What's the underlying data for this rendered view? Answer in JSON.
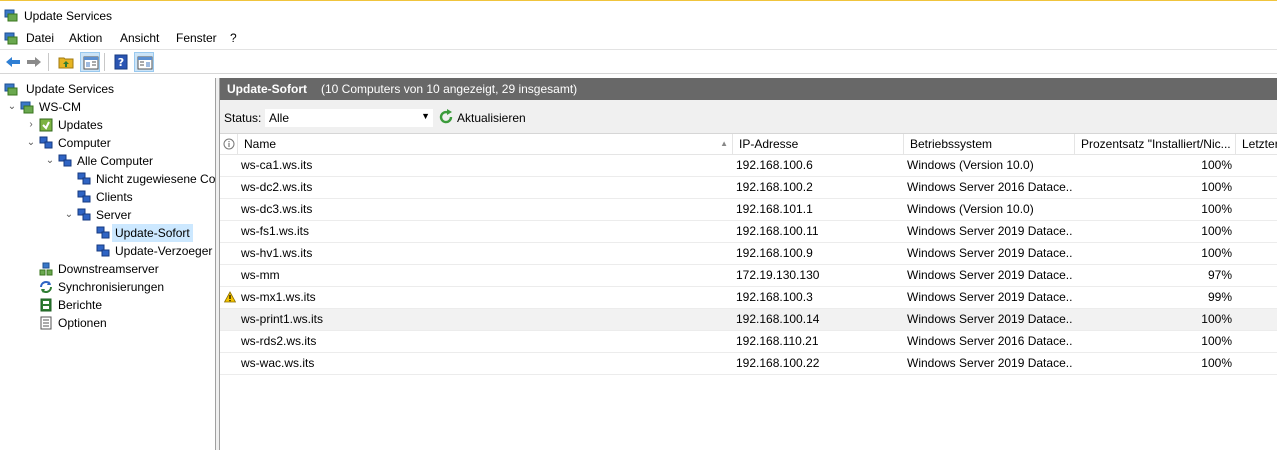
{
  "window": {
    "title": "Update Services"
  },
  "menu": {
    "items": [
      "Datei",
      "Aktion",
      "Ansicht",
      "Fenster",
      "?"
    ]
  },
  "toolbar": {
    "buttons": [
      "back-icon",
      "forward-icon",
      "folder-up-icon",
      "show-hide-tree-icon",
      "help-icon",
      "action-pane-icon"
    ]
  },
  "tree": {
    "root": "Update Services",
    "server": "WS-CM",
    "updates": "Updates",
    "computer": "Computer",
    "all_computers": "Alle Computer",
    "unassigned": "Nicht zugewiesene Co",
    "clients": "Clients",
    "server_group": "Server",
    "update_sofort": "Update-Sofort",
    "update_verzoeger": "Update-Verzoeger",
    "downstream": "Downstreamserver",
    "sync": "Synchronisierungen",
    "reports": "Berichte",
    "options": "Optionen"
  },
  "header": {
    "title": "Update-Sofort",
    "subtitle": "(10 Computers von 10 angezeigt, 29 insgesamt)"
  },
  "filter": {
    "status_label": "Status:",
    "status_value": "Alle",
    "refresh_label": "Aktualisieren"
  },
  "columns": {
    "name": "Name",
    "ip": "IP-Adresse",
    "os": "Betriebssystem",
    "percent": "Prozentsatz \"Installiert/Nic...",
    "last": "Letzter"
  },
  "rows": [
    {
      "name": "ws-ca1.ws.its",
      "ip": "192.168.100.6",
      "os": "Windows (Version 10.0)",
      "percent": "100%"
    },
    {
      "name": "ws-dc2.ws.its",
      "ip": "192.168.100.2",
      "os": "Windows Server 2016 Datace...",
      "percent": "100%"
    },
    {
      "name": "ws-dc3.ws.its",
      "ip": "192.168.101.1",
      "os": "Windows (Version 10.0)",
      "percent": "100%"
    },
    {
      "name": "ws-fs1.ws.its",
      "ip": "192.168.100.11",
      "os": "Windows Server 2019 Datace...",
      "percent": "100%"
    },
    {
      "name": "ws-hv1.ws.its",
      "ip": "192.168.100.9",
      "os": "Windows Server 2019 Datace...",
      "percent": "100%"
    },
    {
      "name": "ws-mm",
      "ip": "172.19.130.130",
      "os": "Windows Server 2019 Datace...",
      "percent": "97%"
    },
    {
      "name": "ws-mx1.ws.its",
      "ip": "192.168.100.3",
      "os": "Windows Server 2019 Datace...",
      "percent": "99%",
      "warning": true
    },
    {
      "name": "ws-print1.ws.its",
      "ip": "192.168.100.14",
      "os": "Windows Server 2019 Datace...",
      "percent": "100%",
      "highlight": true
    },
    {
      "name": "ws-rds2.ws.its",
      "ip": "192.168.110.21",
      "os": "Windows Server 2016 Datace...",
      "percent": "100%"
    },
    {
      "name": "ws-wac.ws.its",
      "ip": "192.168.100.22",
      "os": "Windows Server 2019 Datace...",
      "percent": "100%"
    }
  ]
}
